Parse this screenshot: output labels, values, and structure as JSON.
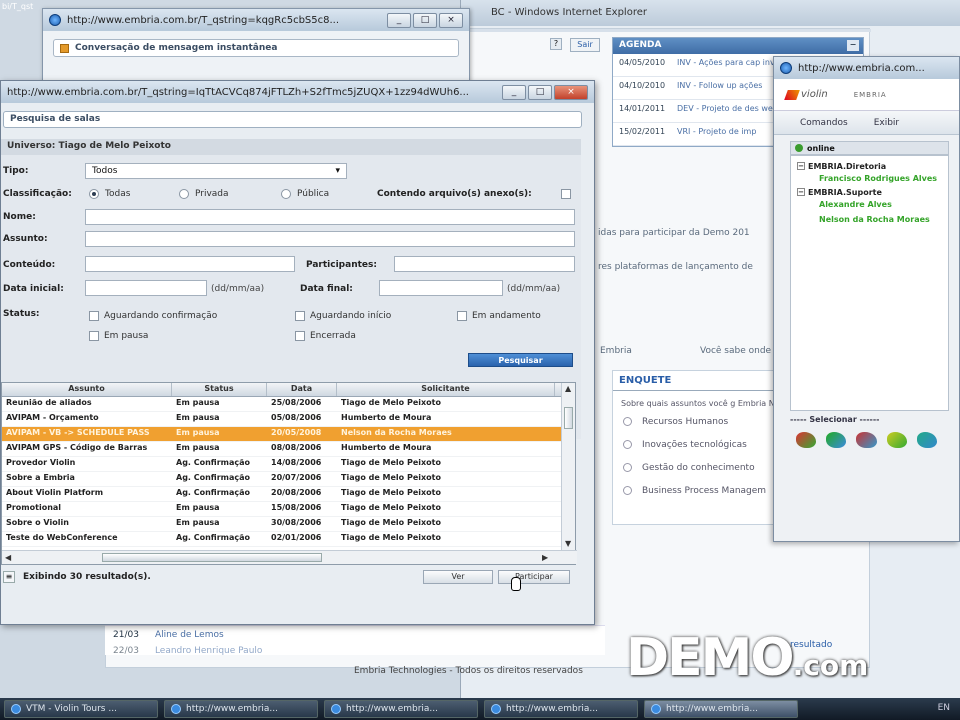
{
  "bg_window": {
    "title": "BC - Windows Internet Explorer",
    "sair": "Sair",
    "url_fragment": "bi/T_qst",
    "agenda": {
      "title": "AGENDA",
      "items": [
        {
          "date": "04/05/2010",
          "text": "INV - Ações para cap investidor para a Emb"
        },
        {
          "date": "04/10/2010",
          "text": "INV - Follow up ações"
        },
        {
          "date": "14/01/2011",
          "text": "DEV - Projeto de des website - Davrict"
        },
        {
          "date": "15/02/2011",
          "text": "VRI - Projeto de imp"
        }
      ]
    },
    "text_line_1": "idas para participar da Demo 201",
    "text_line_2": "res plataformas de lançamento de",
    "link_embria": "Embria",
    "link_voce": "Você sabe onde",
    "enquete": {
      "title": "ENQUETE",
      "question": "Sobre quais assuntos você g Embria Network?",
      "options": [
        "Recursos Humanos",
        "Inovações tecnológicas",
        "Gestão do conhecimento",
        "Business Process Managem"
      ]
    },
    "bottom_item": {
      "date": "21/03",
      "name": "Aline de Lemos"
    },
    "bottom_item_2": {
      "date": "22/03",
      "name": "Leandro Henrique Paulo"
    },
    "bottom_right": "resultado",
    "footer": "Embria Technologies - Todos os direitos reservados"
  },
  "chat_window": {
    "url": "http://www.embria.com.br/T_qstring=kqgRc5cbS5c8...",
    "header": "Conversação de mensagem instantânea"
  },
  "messenger": {
    "url": "http://www.embria.com...",
    "logo_violin": "violin",
    "logo_embria": "EMBRIA",
    "menu": [
      "Comandos",
      "Exibir"
    ],
    "online_label": "online",
    "groups": [
      {
        "name": "EMBRIA.Diretoria",
        "users": [
          "Francisco Rodrigues Alves"
        ]
      },
      {
        "name": "EMBRIA.Suporte",
        "users": [
          "Alexandre Alves",
          "Nelson da Rocha Moraes"
        ]
      }
    ],
    "select_label": "----- Selecionar ------"
  },
  "search_window": {
    "url": "http://www.embria.com.br/T_qstring=IqTtACVCq874jFTLZh+S2fTmc5jZUQX+1zz94dWUh6...",
    "header": "Pesquisa de salas",
    "universo": "Universo: Tiago de Melo Peixoto",
    "tipo_label": "Tipo:",
    "tipo_value": "Todos",
    "classificacao_label": "Classificação:",
    "class_options": [
      "Todas",
      "Privada",
      "Pública"
    ],
    "anexo_label": "Contendo arquivo(s) anexo(s):",
    "nome_label": "Nome:",
    "assunto_label": "Assunto:",
    "conteudo_label": "Conteúdo:",
    "participantes_label": "Participantes:",
    "data_inicial_label": "Data inicial:",
    "data_final_label": "Data final:",
    "date_hint": "(dd/mm/aa)",
    "status_label": "Status:",
    "status_options": [
      "Aguardando confirmação",
      "Aguardando início",
      "Em andamento",
      "Em pausa",
      "Encerrada"
    ],
    "pesquisar_label": "Pesquisar",
    "columns": [
      "Assunto",
      "Status",
      "Data",
      "Solicitante"
    ],
    "rows": [
      [
        "Reunião de aliados",
        "Em pausa",
        "25/08/2006",
        "Tiago de Melo Peixoto"
      ],
      [
        "AVIPAM - Orçamento",
        "Em pausa",
        "05/08/2006",
        "Humberto de Moura"
      ],
      [
        "AVIPAM - VB -> SCHEDULE PASS",
        "Em pausa",
        "20/05/2008",
        "Nelson da Rocha Moraes"
      ],
      [
        "AVIPAM GPS - Código de Barras",
        "Em pausa",
        "08/08/2006",
        "Humberto de Moura"
      ],
      [
        "Provedor Violin",
        "Ag. Confirmação",
        "14/08/2006",
        "Tiago de Melo Peixoto"
      ],
      [
        "Sobre a Embria",
        "Ag. Confirmação",
        "20/07/2006",
        "Tiago de Melo Peixoto"
      ],
      [
        "About Violin Platform",
        "Ag. Confirmação",
        "20/08/2006",
        "Tiago de Melo Peixoto"
      ],
      [
        "Promotional",
        "Em pausa",
        "15/08/2006",
        "Tiago de Melo Peixoto"
      ],
      [
        "Sobre o Violin",
        "Em pausa",
        "30/08/2006",
        "Tiago de Melo Peixoto"
      ],
      [
        "Teste do WebConference",
        "Ag. Confirmação",
        "02/01/2006",
        "Tiago de Melo Peixoto"
      ]
    ],
    "selected_row": 2,
    "result_count": "Exibindo 30 resultado(s).",
    "ver_label": "Ver",
    "participar_label": "Participar"
  },
  "taskbar": {
    "items": [
      "VTM - Violin Tours ...",
      "http://www.embria...",
      "http://www.embria...",
      "http://www.embria...",
      "http://www.embria..."
    ],
    "active_index": 4,
    "tray_lang": "EN"
  },
  "watermark": {
    "big": "DEMO",
    "small": ".com"
  },
  "colors": {
    "accent": "#3f6da6",
    "selection": "#f0a030",
    "online_user": "#35a42a"
  }
}
